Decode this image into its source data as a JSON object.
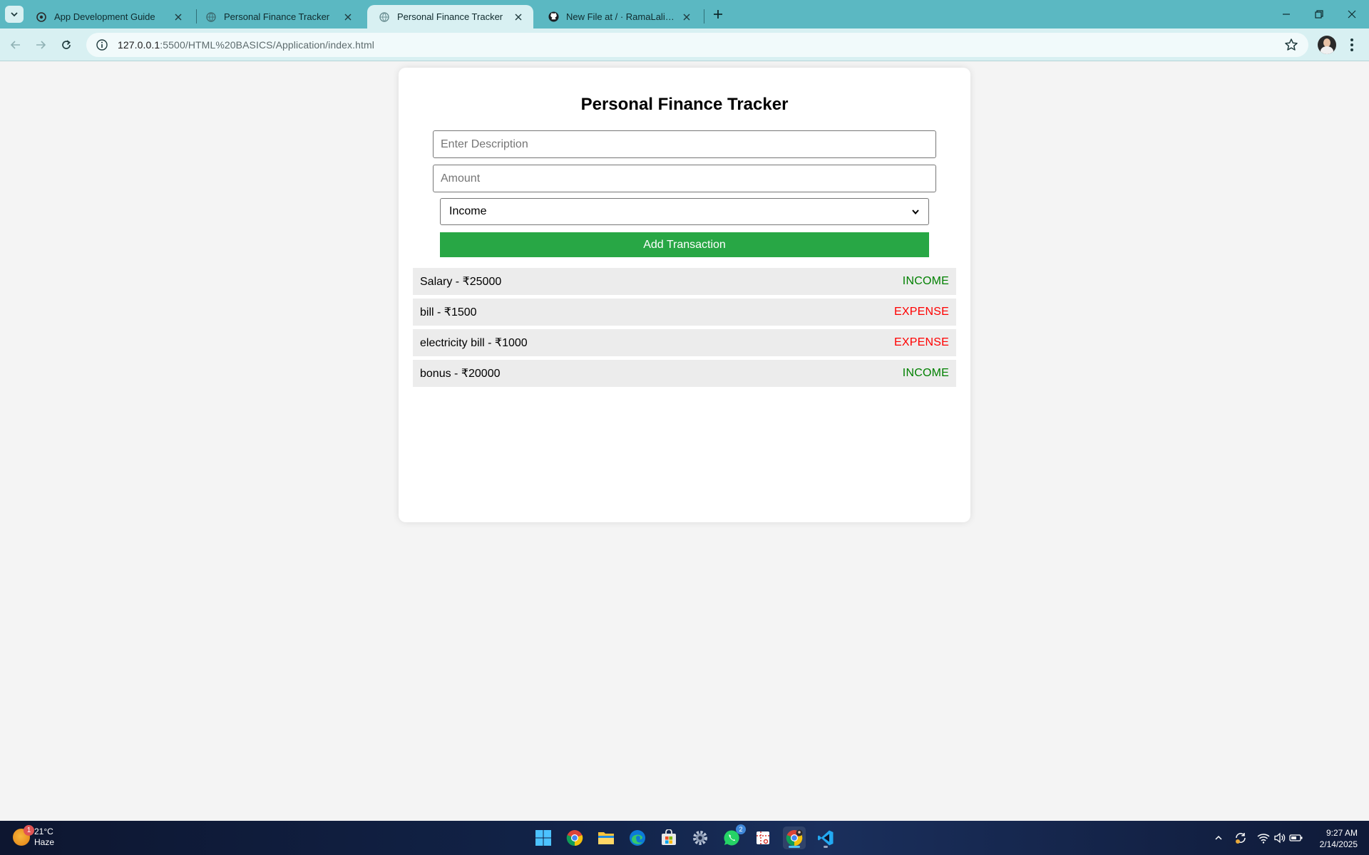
{
  "browser": {
    "tabs": [
      {
        "title": "App Development Guide",
        "active": false,
        "favicon": "openai-icon"
      },
      {
        "title": "Personal Finance Tracker",
        "active": false,
        "favicon": "globe-icon"
      },
      {
        "title": "Personal Finance Tracker",
        "active": true,
        "favicon": "globe-icon"
      },
      {
        "title": "New File at / · RamaLalithya/Pe",
        "active": false,
        "favicon": "github-icon"
      }
    ],
    "address": {
      "host": "127.0.0.1",
      "path": ":5500/HTML%20BASICS/Application/index.html"
    }
  },
  "app": {
    "title": "Personal Finance Tracker",
    "description_placeholder": "Enter Description",
    "amount_placeholder": "Amount",
    "type_selected": "Income",
    "type_options": [
      "Income"
    ],
    "add_button": "Add Transaction",
    "transactions": [
      {
        "label": "Salary - ₹25000",
        "type": "INCOME"
      },
      {
        "label": "bill - ₹1500",
        "type": "EXPENSE"
      },
      {
        "label": "electricity bill - ₹1000",
        "type": "EXPENSE"
      },
      {
        "label": "bonus - ₹20000",
        "type": "INCOME"
      }
    ],
    "colors": {
      "income": "#008000",
      "expense": "#ff0000",
      "button": "#28a745"
    }
  },
  "taskbar": {
    "weather": {
      "temp": "21°C",
      "condition": "Haze",
      "badge": "1"
    },
    "apps": [
      "windows-start-icon",
      "chrome-icon",
      "file-explorer-icon",
      "edge-icon",
      "store-icon",
      "settings-icon",
      "whatsapp-icon",
      "snipping-tool-icon",
      "chrome-profile-icon",
      "vscode-icon"
    ],
    "whatsapp_badge": "2",
    "clock": {
      "time": "9:27 AM",
      "date": "2/14/2025"
    }
  }
}
